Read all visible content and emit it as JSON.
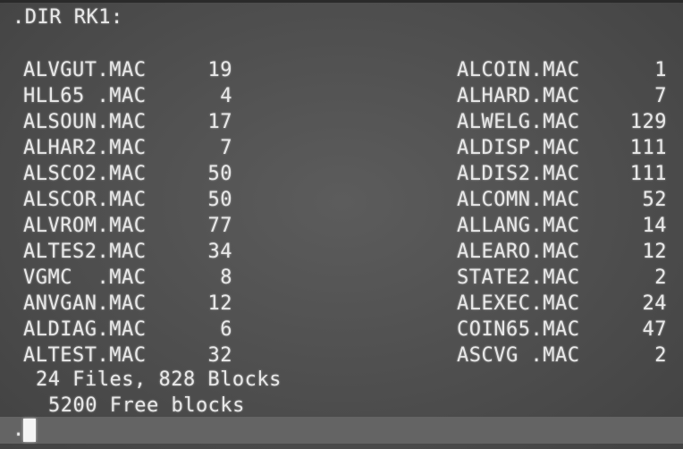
{
  "terminal": {
    "command": ".DIR RK1:",
    "left_column": [
      {
        "name": "ALVGUT.MAC",
        "size": "19"
      },
      {
        "name": "HLL65 .MAC",
        "size": "4"
      },
      {
        "name": "ALSOUN.MAC",
        "size": "17"
      },
      {
        "name": "ALHAR2.MAC",
        "size": "7"
      },
      {
        "name": "ALSCO2.MAC",
        "size": "50"
      },
      {
        "name": "ALSCOR.MAC",
        "size": "50"
      },
      {
        "name": "ALVROM.MAC",
        "size": "77"
      },
      {
        "name": "ALTES2.MAC",
        "size": "34"
      },
      {
        "name": "VGMC  .MAC",
        "size": "8"
      },
      {
        "name": "ANVGAN.MAC",
        "size": "12"
      },
      {
        "name": "ALDIAG.MAC",
        "size": "6"
      },
      {
        "name": "ALTEST.MAC",
        "size": "32"
      }
    ],
    "right_column": [
      {
        "name": "ALCOIN.MAC",
        "size": "1"
      },
      {
        "name": "ALHARD.MAC",
        "size": "7"
      },
      {
        "name": "ALWELG.MAC",
        "size": "129"
      },
      {
        "name": "ALDISP.MAC",
        "size": "111"
      },
      {
        "name": "ALDIS2.MAC",
        "size": "111"
      },
      {
        "name": "ALCOMN.MAC",
        "size": "52"
      },
      {
        "name": "ALLANG.MAC",
        "size": "14"
      },
      {
        "name": "ALEARO.MAC",
        "size": "12"
      },
      {
        "name": "STATE2.MAC",
        "size": "2"
      },
      {
        "name": "ALEXEC.MAC",
        "size": "24"
      },
      {
        "name": "COIN65.MAC",
        "size": "47"
      },
      {
        "name": "ASCVG .MAC",
        "size": "2"
      }
    ],
    "summary_files": "24 Files, 828 Blocks",
    "summary_free": "5200 Free blocks",
    "prompt": "."
  }
}
